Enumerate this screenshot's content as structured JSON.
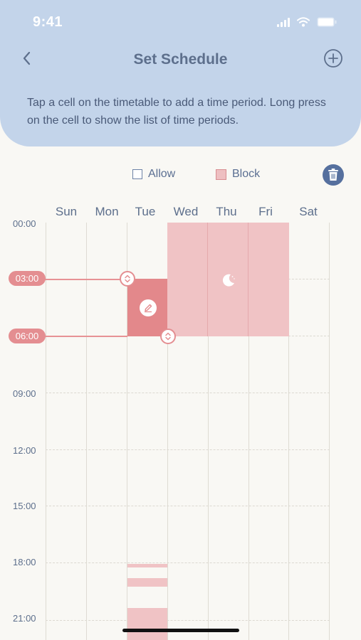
{
  "status_bar": {
    "time": "9:41"
  },
  "header": {
    "title": "Set Schedule"
  },
  "hint": {
    "text": "Tap a cell on the timetable to add a time period. Long press on the cell to show the list of time periods."
  },
  "legend": {
    "allow_label": "Allow",
    "block_label": "Block"
  },
  "days": [
    "Sun",
    "Mon",
    "Tue",
    "Wed",
    "Thu",
    "Fri",
    "Sat"
  ],
  "times": [
    "00:00",
    "03:00",
    "06:00",
    "09:00",
    "12:00",
    "15:00",
    "18:00",
    "21:00"
  ],
  "selection": {
    "day": "Tue",
    "start": "03:00",
    "end": "06:00"
  },
  "colors": {
    "header_bg": "#c3d4ea",
    "block": "#f0c3c5",
    "block_selected": "#e3888b",
    "accent": "#56709e"
  }
}
